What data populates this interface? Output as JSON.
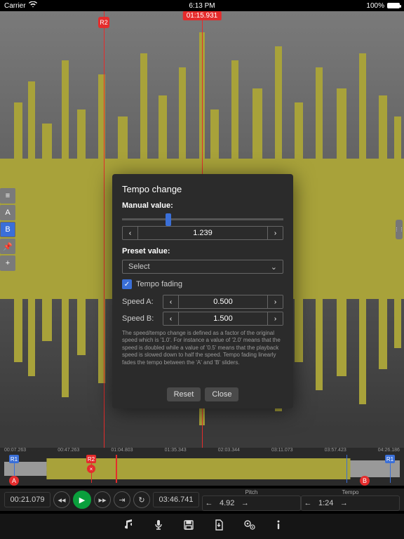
{
  "status": {
    "carrier": "Carrier",
    "time": "6:13 PM",
    "battery": "100%"
  },
  "playhead": {
    "time": "01:15.931"
  },
  "markers": {
    "r2": "R2"
  },
  "left_toolbar": {
    "items": [
      "≡",
      "A",
      "B",
      "📌",
      "+"
    ],
    "selected_index": 2
  },
  "modal": {
    "title": "Tempo change",
    "manual_label": "Manual value:",
    "manual_value": "1.239",
    "preset_label": "Preset value:",
    "preset_placeholder": "Select",
    "fading_label": "Tempo fading",
    "fading_checked": true,
    "speed_a_label": "Speed A:",
    "speed_a_value": "0.500",
    "speed_b_label": "Speed B:",
    "speed_b_value": "1.500",
    "help_text": "The speed/tempo change is defined as a factor of the original speed which is '1.0'. For instance a value of '2.0' means that the speed is doubled while a value of '0.5' means that the playback speed is slowed down to half the speed.\nTempo fading linearly fades the tempo between the 'A' and 'B' sliders.",
    "reset": "Reset",
    "close": "Close"
  },
  "overview": {
    "ticks": [
      "00:07.263",
      "00:47.263",
      "01:04.803",
      "01:35.343",
      "02:03.344",
      "03:11.073",
      "03:57.423",
      "04:26.186"
    ],
    "r1": "R1",
    "r2": "R2",
    "a": "A",
    "b": "B"
  },
  "transport": {
    "pos": "00:21.079",
    "dur": "03:46.741",
    "pitch_label": "Pitch",
    "pitch_value": "4.92",
    "tempo_label": "Tempo",
    "tempo_value": "1:24"
  }
}
